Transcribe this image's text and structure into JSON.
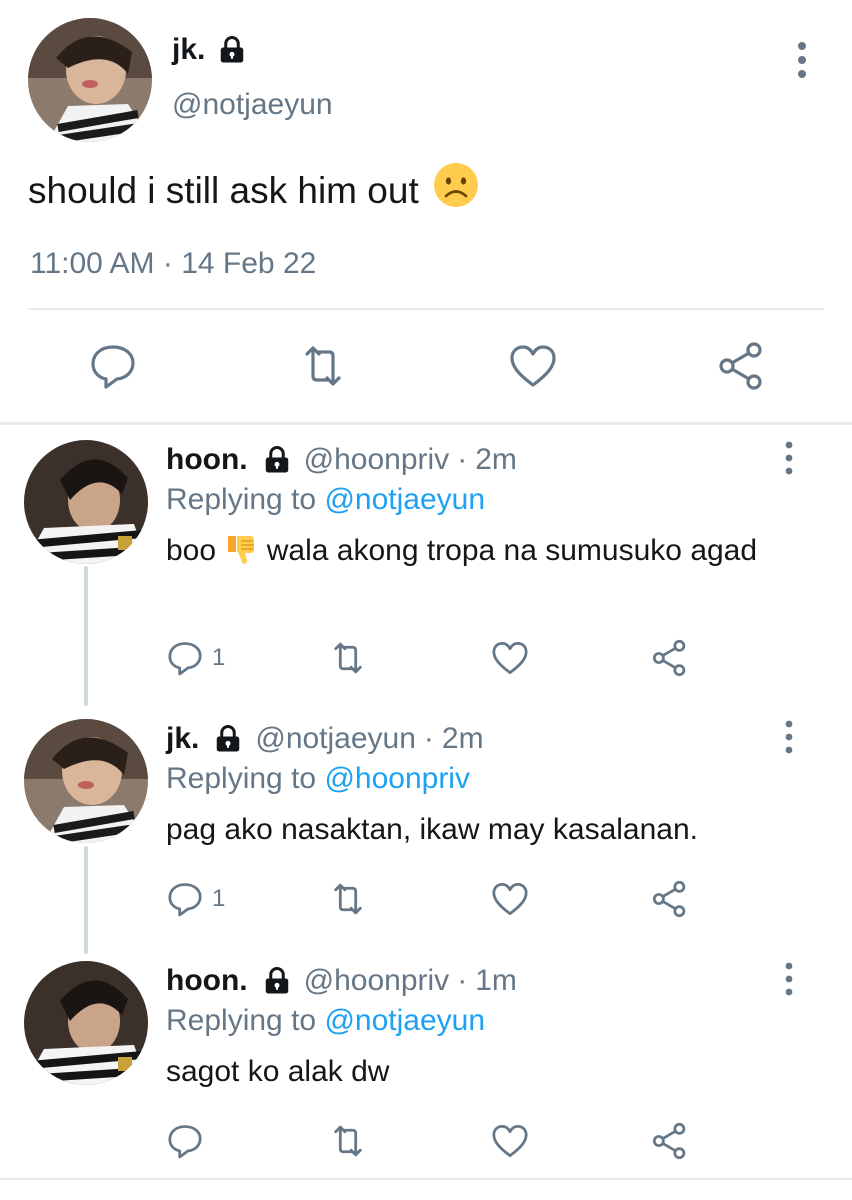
{
  "main_tweet": {
    "display_name": "jk.",
    "handle": "@notjaeyun",
    "text": "should i still ask him out",
    "emoji": "☹️",
    "time": "11:00 AM",
    "separator": "·",
    "date": "14 Feb 22",
    "icons": [
      "lock-icon",
      "more-vertical-icon",
      "reply-icon",
      "retweet-icon",
      "like-icon",
      "share-icon"
    ]
  },
  "replies": [
    {
      "display_name": "hoon.",
      "handle": "@hoonpriv",
      "sep": "·",
      "time": "2m",
      "replying_label": "Replying to",
      "replying_to": "@notjaeyun",
      "text_before": "boo ",
      "emoji": "👎",
      "text_after": " wala akong tropa na sumusuko agad",
      "reply_count": "1"
    },
    {
      "display_name": "jk.",
      "handle": "@notjaeyun",
      "sep": "·",
      "time": "2m",
      "replying_label": "Replying to",
      "replying_to": "@hoonpriv",
      "text": "pag ako nasaktan, ikaw may kasalanan.",
      "reply_count": "1"
    },
    {
      "display_name": "hoon.",
      "handle": "@hoonpriv",
      "sep": "·",
      "time": "1m",
      "replying_label": "Replying to",
      "replying_to": "@notjaeyun",
      "text": "sagot ko alak dw",
      "reply_count": ""
    }
  ],
  "colors": {
    "text": "#14171a",
    "secondary": "#657786",
    "link": "#1da1f2",
    "divider": "#e6ecf0",
    "thread_line": "#cfd9de"
  }
}
